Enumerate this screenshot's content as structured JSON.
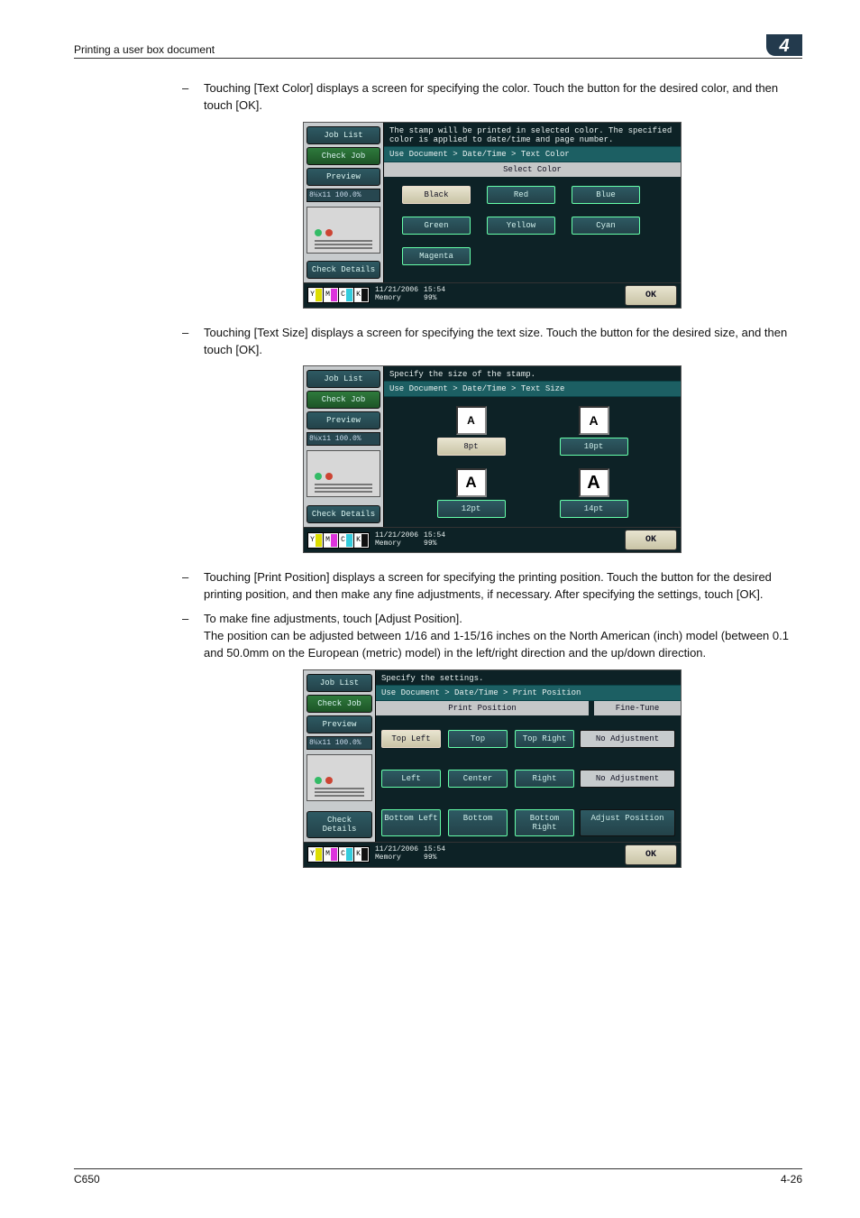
{
  "page": {
    "header_title": "Printing a user box document",
    "chapter_badge": "4",
    "footer_left": "C650",
    "footer_right": "4-26"
  },
  "bullets": {
    "b1": "Touching [Text Color] displays a screen for specifying the color. Touch the button for the desired color, and then touch [OK].",
    "b2": "Touching [Text Size] displays a screen for specifying the text size. Touch the button for the desired size, and then touch [OK].",
    "b3": "Touching [Print Position] displays a screen for specifying the printing position. Touch the button for the desired printing position, and then make any fine adjustments, if necessary. After specifying the settings, touch [OK].",
    "b4a": "To make fine adjustments, touch [Adjust Position].",
    "b4b": "The position can be adjusted between 1/16 and 1-15/16 inches on the North American (inch) model (between 0.1 and 50.0mm on the European (metric) model) in the left/right direction and the up/down direction."
  },
  "dash": "–",
  "sidebar": {
    "job_list": "Job List",
    "check_job": "Check Job",
    "preview": "Preview",
    "pct_label": "8½x11   100.0%",
    "check_details": "Check Details"
  },
  "status": {
    "date": "11/21/2006",
    "time": "15:54",
    "mem_label": "Memory",
    "mem_val": "99%",
    "ok": "OK"
  },
  "toner": {
    "y": "Y",
    "m": "M",
    "c": "C",
    "k": "K"
  },
  "panel_color": {
    "msg": "The stamp will be printed in selected color. The specified color is applied to date/time and page number.",
    "crumb": "Use Document > Date/Time > Text Color",
    "subhead": "Select Color",
    "options": {
      "black": "Black",
      "red": "Red",
      "blue": "Blue",
      "green": "Green",
      "yellow": "Yellow",
      "cyan": "Cyan",
      "magenta": "Magenta"
    }
  },
  "panel_size": {
    "msg": "Specify the size of the stamp.",
    "crumb": "Use Document > Date/Time > Text Size",
    "letter": "A",
    "opts": {
      "s8": "8pt",
      "s10": "10pt",
      "s12": "12pt",
      "s14": "14pt"
    }
  },
  "panel_pos": {
    "msg": "Specify the settings.",
    "crumb": "Use Document > Date/Time > Print Position",
    "h1": "Print Position",
    "h2": "Fine-Tune",
    "grid": {
      "tl": "Top Left",
      "t": "Top",
      "tr": "Top Right",
      "l": "Left",
      "c": "Center",
      "r": "Right",
      "bl": "Bottom Left",
      "b": "Bottom",
      "br": "Bottom Right"
    },
    "no_adj": "No Adjustment",
    "adj_pos": "Adjust Position"
  }
}
